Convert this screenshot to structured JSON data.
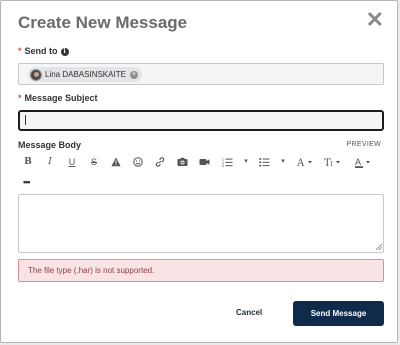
{
  "dialog": {
    "title": "Create New Message",
    "close_symbol": "✕"
  },
  "send_to": {
    "label": "Send to",
    "required_mark": "*",
    "info_symbol": "i",
    "recipient_name": "Lina DABASINSKAITE",
    "remove_symbol": "×"
  },
  "subject": {
    "label": "Message Subject",
    "required_mark": "*",
    "value": ""
  },
  "body": {
    "label": "Message Body",
    "preview_label": "PREVIEW",
    "value": "",
    "toolbar": {
      "bold": "B",
      "italic": "I",
      "underline": "U",
      "strikethrough": "S",
      "dropdown_caret": "▾",
      "text_color_letter": "A",
      "more": "•••"
    }
  },
  "error": {
    "message": "The file type (.har) is not supported."
  },
  "actions": {
    "cancel_label": "Cancel",
    "send_label": "Send Message"
  },
  "colors": {
    "primary_button": "#102a4c",
    "error_background": "#f9e3e4",
    "error_border": "#e08e93",
    "required": "#d9534f"
  }
}
